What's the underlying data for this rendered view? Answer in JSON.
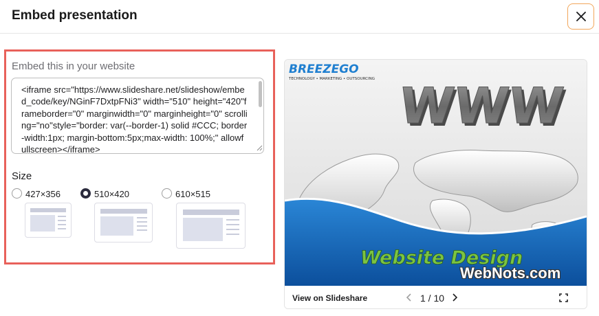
{
  "modal": {
    "title": "Embed presentation",
    "close_icon": "close-icon"
  },
  "embed": {
    "label": "Embed this in your website",
    "code": "<iframe src=\"https://www.slideshare.net/slideshow/embed_code/key/NGinF7DxtpFNi3\" width=\"510\" height=\"420\"frameborder=\"0\" marginwidth=\"0\" marginheight=\"0\" scrolling=\"no\"style=\"border: var(--border-1) solid #CCC; border-width:1px; margin-bottom:5px;max-width: 100%;\" allowfullscreen></iframe>"
  },
  "size": {
    "label": "Size",
    "options": [
      {
        "label": "427×356",
        "checked": false
      },
      {
        "label": "510×420",
        "checked": true
      },
      {
        "label": "610×515",
        "checked": false
      }
    ]
  },
  "preview": {
    "logo_text": "BREEZEGO",
    "logo_tagline": "TECHNOLOGY • MARKETING • OUTSOURCING",
    "headline": "WWW",
    "slide_caption": "Website Design",
    "watermark": "WebNots.com",
    "view_link": "View on Slideshare",
    "page_indicator": "1 / 10",
    "icons": [
      "chevron-left-icon",
      "chevron-right-icon",
      "fullscreen-icon"
    ]
  },
  "colors": {
    "highlight_border": "#e8615a",
    "close_border": "#f2a65a",
    "slide_blue": "#1a73c7",
    "caption_green": "#7bc442"
  }
}
